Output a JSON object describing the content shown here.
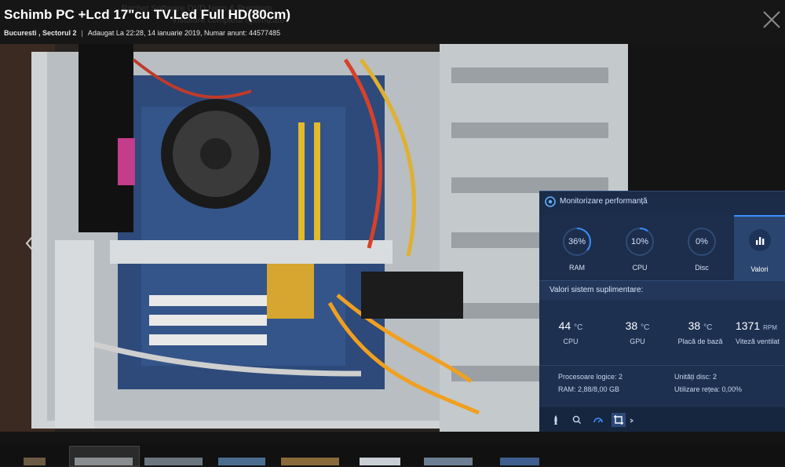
{
  "listing": {
    "ghost_line1": "Pachet Software DVD Nero & Premium",
    "ghost_line2": "instalare completa optimizate",
    "title": "Schimb PC +Lcd 17\"cu TV.Led Full HD(80cm)",
    "location": "Bucuresti , Sectorul 2",
    "separator": "|",
    "added": "Adaugat La 22:28, 14 ianuarie 2019, Numar anunt: 44577485"
  },
  "monitor": {
    "title": "Monitorizare performanță",
    "gauges": [
      {
        "label": "RAM",
        "value": "36%",
        "fraction": 0.36
      },
      {
        "label": "CPU",
        "value": "10%",
        "fraction": 0.1
      },
      {
        "label": "Disc",
        "value": "0%",
        "fraction": 0.0
      }
    ],
    "tab_values_label": "Valori",
    "section_title": "Valori sistem suplimentare:",
    "sensors": [
      {
        "value": "44",
        "unit": "°C",
        "name": "CPU"
      },
      {
        "value": "38",
        "unit": "°C",
        "name": "GPU"
      },
      {
        "value": "38",
        "unit": "°C",
        "name": "Placă de bază"
      },
      {
        "value": "1371",
        "unit": "RPM",
        "name": "Viteză ventilat"
      }
    ],
    "extra": {
      "logical_processors": "Procesoare logice: 2",
      "ram": "RAM: 2,88/8,00 GB",
      "disk_units": "Unități disc: 2",
      "network": "Utilizare rețea: 0,00%"
    },
    "accent_color": "#3a8dff"
  }
}
